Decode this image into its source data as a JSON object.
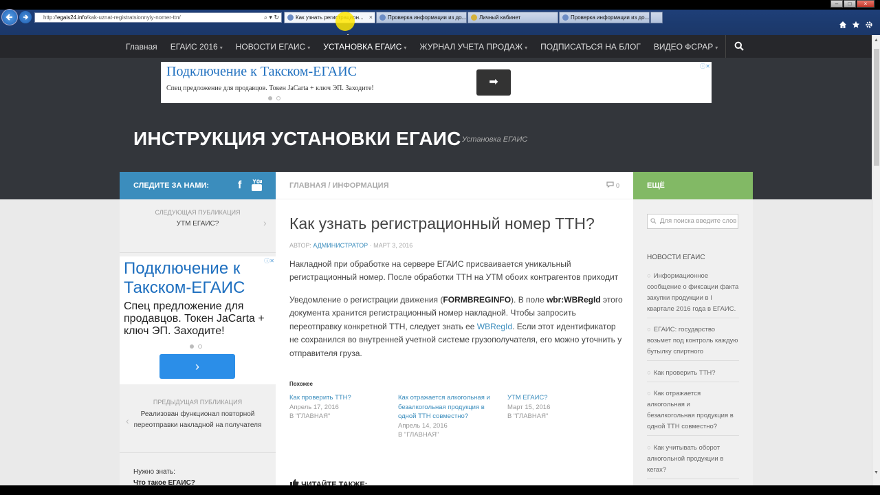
{
  "browser": {
    "url_prefix": "http://",
    "url_domain": "egais24.info",
    "url_path": "/kak-uznat-registratsionnyiy-nomer-ttn/",
    "address_icons": "⌕ ▾ ↻",
    "tabs": [
      {
        "label": "Как узнать регистрацион...",
        "active": true
      },
      {
        "label": "Проверка информации из до...",
        "active": false
      },
      {
        "label": "Личный кабинет",
        "active": false
      },
      {
        "label": "Проверка информации из до...",
        "active": false
      }
    ],
    "window_buttons": [
      "–",
      "□",
      "×"
    ],
    "tab_close": "×"
  },
  "nav": {
    "items": [
      {
        "label": "Главная",
        "caret": ""
      },
      {
        "label": "ЕГАИС 2016",
        "caret": "▾"
      },
      {
        "label": "НОВОСТИ ЕГАИС",
        "caret": "▾"
      },
      {
        "label": "УСТАНОВКА ЕГАИС",
        "caret": "▾"
      },
      {
        "label": "ЖУРНАЛ УЧЕТА ПРОДАЖ",
        "caret": "▾"
      },
      {
        "label": "ПОДПИСАТЬСЯ НА БЛОГ",
        "caret": ""
      },
      {
        "label": "ВИДЕО ФСРАР",
        "caret": "▾"
      }
    ]
  },
  "top_ad": {
    "title": "Подключение к Такском-ЕГАИС",
    "text": "Спец предложение для продавцов. Токен JaCarta + ключ ЭП. Заходите!",
    "button_glyph": "➡",
    "mark": "ⓘ✕"
  },
  "site": {
    "title": "ИНСТРУКЦИЯ УСТАНОВКИ ЕГАИС",
    "description": "Установка ЕГАИС"
  },
  "left": {
    "follow_label": "СЛЕДИТЕ ЗА НАМИ:",
    "fb_glyph": "f",
    "next_kicker": "СЛЕДУЮЩАЯ ПУБЛИКАЦИЯ",
    "next_title": "УТМ ЕГАИС?",
    "chev_right": "›",
    "chev_left": "‹",
    "ad_title": "Подключение к Такском-ЕГАИС",
    "ad_text": "Спец предложение для продавцов. Токен JaCarta + ключ ЭП. Заходите!",
    "ad_button": "›",
    "prev_kicker": "ПРЕДЫДУЩАЯ ПУБЛИКАЦИЯ",
    "prev_title": "Реализован функционал повторной переотправки накладной на получателя",
    "know_label": "Нужно знать:",
    "know_link": "Что такое ЕГАИС?"
  },
  "main": {
    "breadcrumb": "ГЛАВНАЯ / ИНФОРМАЦИЯ",
    "comments_count": "0",
    "title": "Как узнать регистрационный номер ТТН?",
    "byline_prefix": "АВТОР:",
    "author": "АДМИНИСТРАТОР",
    "byline_sep": " · ",
    "date": "МАРТ 3, 2016",
    "para1": "Накладной при обработке на сервере ЕГАИС присваивается уникальный регистрационный номер. После обработки ТТН на УТМ обоих контрагентов приходит",
    "para2_a": "Уведомление о регистрации движения (",
    "para2_b": "FORMBREGINFO",
    "para2_c": "). В поле ",
    "para2_d": "wbr:WBRegId",
    "para2_e": " этого документа хранится регистрационный номер накладной. Чтобы запросить переотправку конкретной ТТН, следует знать ее ",
    "para2_f": "WBRegId",
    "para2_g": ". Если этот идентификатор не сохранился во внутренней учетной системе грузополучателя, его можно уточнить у отправителя груза.",
    "related_heading": "Похожее",
    "related": [
      {
        "title": "Как проверить ТТН?",
        "date": "Апрель 17, 2016",
        "category": "В \"ГЛАВНАЯ\""
      },
      {
        "title": "Как отражается алкогольная и безалкогольная продукция в одной ТТН совместно?",
        "date": "Апрель 14, 2016",
        "category": "В \"ГЛАВНАЯ\""
      },
      {
        "title": "УТМ ЕГАИС?",
        "date": "Март 15, 2016",
        "category": "В \"ГЛАВНАЯ\""
      }
    ],
    "read_also": "ЧИТАЙТЕ ТАКЖЕ:"
  },
  "right": {
    "more_label": "ЕЩЁ",
    "search_placeholder": "Для поиска введите слов",
    "news_heading": "НОВОСТИ ЕГАИС",
    "news": [
      "Информационное сообщение о фиксации факта закупки продукции в I квартале 2016 года в ЕГАИС.",
      "ЕГАИС: государство возьмет под контроль каждую бутылку спиртного",
      "Как проверить ТТН?",
      "Как отражается алкогольная и безалкогольная продукция в одной ТТН совместно?",
      "Как учитывать оборот алкогольной продукции в кегах?"
    ],
    "bullet": "○"
  },
  "colors": {
    "follow_blue": "#3b8dbd",
    "more_green": "#82b965",
    "header_dark": "#33363b",
    "nav_dark": "#26272b"
  }
}
